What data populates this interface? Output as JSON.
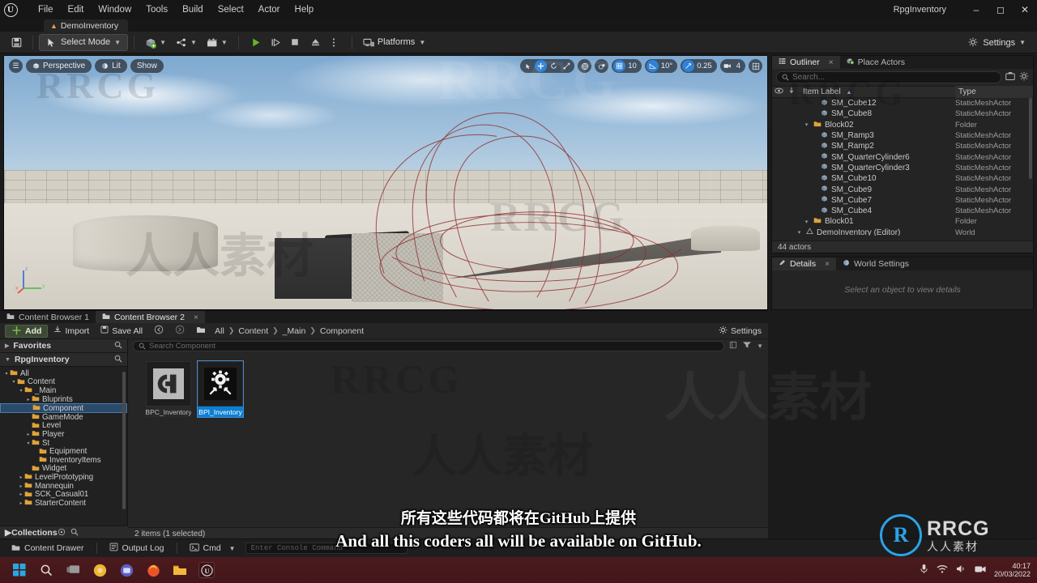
{
  "titlebar": {
    "logo": "ue-logo",
    "menus": [
      "File",
      "Edit",
      "Window",
      "Tools",
      "Build",
      "Select",
      "Actor",
      "Help"
    ],
    "project_name": "RpgInventory",
    "minimize": "–",
    "maximize": "◻",
    "close": "✕"
  },
  "level_tab": {
    "label": "DemoInventory",
    "icon": "level-icon"
  },
  "toolbar": {
    "save_icon": "save-icon",
    "mode_label": "Select Mode",
    "add_icon": "add-actor-icon",
    "blueprint_icon": "blueprints-icon",
    "cinematics_icon": "cinematics-icon",
    "play_icon": "play-icon",
    "skip_icon": "skip-icon",
    "stop_icon": "stop-icon",
    "eject_icon": "eject-icon",
    "options_icon": "play-options-icon",
    "platforms_label": "Platforms",
    "settings_label": "Settings"
  },
  "viewport": {
    "menu_icon": "viewport-menu-icon",
    "camera_label": "Perspective",
    "lighting_label": "Lit",
    "show_label": "Show",
    "transform_tools": [
      "select-icon",
      "move-icon",
      "rotate-icon",
      "scale-icon"
    ],
    "coord_icon": "world-coords-icon",
    "surface_snap_icon": "surface-snap-icon",
    "grid_snap_icon": "grid-snap-icon",
    "grid_snap_value": "10",
    "angle_snap_icon": "angle-snap-icon",
    "angle_snap_value": "10°",
    "scale_snap_icon": "scale-snap-icon",
    "scale_snap_value": "0.25",
    "camera_speed_icon": "camera-speed-icon",
    "camera_speed_value": "4",
    "maximize_icon": "maximize-viewport-icon",
    "gizmo_x": "x",
    "gizmo_y": "y",
    "gizmo_z": "z"
  },
  "outliner": {
    "tab_label": "Outliner",
    "tab_icon": "outliner-icon",
    "tab_close": "×",
    "place_actors_label": "Place Actors",
    "place_actors_icon": "place-actors-icon",
    "search_placeholder": "Search...",
    "search_icon": "search-icon",
    "save_view_icon": "save-view-icon",
    "settings_icon": "gear-icon",
    "col_visibility": "eye-icon",
    "col_pin": "pin-icon",
    "col_label": "Item Label",
    "sort_arrow": "▲",
    "col_type": "Type",
    "rows": [
      {
        "name": "DemoInventory (Editor)",
        "type": "World",
        "indent": 1,
        "icon": "world-icon",
        "twisty": "▾"
      },
      {
        "name": "Block01",
        "type": "Folder",
        "indent": 2,
        "icon": "folder-icon",
        "twisty": "▾"
      },
      {
        "name": "SM_Cube4",
        "type": "StaticMeshActor",
        "indent": 3,
        "icon": "mesh-icon",
        "twisty": ""
      },
      {
        "name": "SM_Cube7",
        "type": "StaticMeshActor",
        "indent": 3,
        "icon": "mesh-icon",
        "twisty": ""
      },
      {
        "name": "SM_Cube9",
        "type": "StaticMeshActor",
        "indent": 3,
        "icon": "mesh-icon",
        "twisty": ""
      },
      {
        "name": "SM_Cube10",
        "type": "StaticMeshActor",
        "indent": 3,
        "icon": "mesh-icon",
        "twisty": ""
      },
      {
        "name": "SM_QuarterCylinder3",
        "type": "StaticMeshActor",
        "indent": 3,
        "icon": "mesh-icon",
        "twisty": ""
      },
      {
        "name": "SM_QuarterCylinder6",
        "type": "StaticMeshActor",
        "indent": 3,
        "icon": "mesh-icon",
        "twisty": ""
      },
      {
        "name": "SM_Ramp2",
        "type": "StaticMeshActor",
        "indent": 3,
        "icon": "mesh-icon",
        "twisty": ""
      },
      {
        "name": "SM_Ramp3",
        "type": "StaticMeshActor",
        "indent": 3,
        "icon": "mesh-icon",
        "twisty": ""
      },
      {
        "name": "Block02",
        "type": "Folder",
        "indent": 2,
        "icon": "folder-icon",
        "twisty": "▾"
      },
      {
        "name": "SM_Cube8",
        "type": "StaticMeshActor",
        "indent": 3,
        "icon": "mesh-icon",
        "twisty": ""
      },
      {
        "name": "SM_Cube12",
        "type": "StaticMeshActor",
        "indent": 3,
        "icon": "mesh-icon",
        "twisty": ""
      }
    ],
    "status": "44 actors"
  },
  "details": {
    "tab_label": "Details",
    "tab_icon": "details-icon",
    "tab_close": "×",
    "world_settings_label": "World Settings",
    "world_settings_icon": "world-settings-icon",
    "empty_message": "Select an object to view details"
  },
  "content_browser": {
    "tabs": [
      {
        "label": "Content Browser 1",
        "active": false,
        "close": ""
      },
      {
        "label": "Content Browser 2",
        "active": true,
        "close": "×"
      }
    ],
    "add_label": "Add",
    "add_icon": "plus-icon",
    "import_label": "Import",
    "import_icon": "import-icon",
    "save_all_label": "Save All",
    "save_all_icon": "save-icon",
    "back_icon": "back-arrow-icon",
    "forward_icon": "forward-arrow-icon",
    "path_icon": "folder-icon",
    "breadcrumbs": [
      "All",
      "Content",
      "_Main",
      "Component"
    ],
    "breadcrumb_sep": "❯",
    "settings_label": "Settings",
    "settings_icon": "gear-icon",
    "favorites_label": "Favorites",
    "favorites_search_icon": "search-icon",
    "source_label": "RpgInventory",
    "source_search_icon": "search-icon",
    "collections_label": "Collections",
    "collections_add_icon": "add-collection-icon",
    "collections_search_icon": "search-icon",
    "folder_tree": [
      {
        "name": "All",
        "indent": 0,
        "twisty": "▾",
        "selected": false
      },
      {
        "name": "Content",
        "indent": 1,
        "twisty": "▾",
        "selected": false
      },
      {
        "name": "_Main",
        "indent": 2,
        "twisty": "▾",
        "selected": false
      },
      {
        "name": "Bluprints",
        "indent": 3,
        "twisty": "▸",
        "selected": false
      },
      {
        "name": "Component",
        "indent": 3,
        "twisty": "",
        "selected": true
      },
      {
        "name": "GameMode",
        "indent": 3,
        "twisty": "",
        "selected": false
      },
      {
        "name": "Level",
        "indent": 3,
        "twisty": "",
        "selected": false
      },
      {
        "name": "Player",
        "indent": 3,
        "twisty": "▸",
        "selected": false
      },
      {
        "name": "St",
        "indent": 3,
        "twisty": "▾",
        "selected": false
      },
      {
        "name": "Equipment",
        "indent": 4,
        "twisty": "",
        "selected": false
      },
      {
        "name": "InventoryItems",
        "indent": 4,
        "twisty": "",
        "selected": false
      },
      {
        "name": "Widget",
        "indent": 3,
        "twisty": "",
        "selected": false
      },
      {
        "name": "LevelPrototyping",
        "indent": 2,
        "twisty": "▸",
        "selected": false
      },
      {
        "name": "Mannequin",
        "indent": 2,
        "twisty": "▸",
        "selected": false
      },
      {
        "name": "SCK_Casual01",
        "indent": 2,
        "twisty": "▸",
        "selected": false
      },
      {
        "name": "StarterContent",
        "indent": 2,
        "twisty": "▸",
        "selected": false
      }
    ],
    "search_placeholder": "Search Component",
    "search_icon": "search-icon",
    "view_options_icon": "view-options-icon",
    "filter_icon": "filter-icon",
    "assets": [
      {
        "name": "BPC_Inventory",
        "icon": "blueprint-component-icon",
        "selected": false
      },
      {
        "name": "BPI_Inventory",
        "icon": "blueprint-interface-icon",
        "selected": true
      }
    ],
    "status": "2 items (1 selected)"
  },
  "statusbar": {
    "content_drawer_label": "Content Drawer",
    "content_drawer_icon": "drawer-icon",
    "output_log_label": "Output Log",
    "output_log_icon": "log-icon",
    "cmd_label": "Cmd",
    "cmd_icon": "console-icon",
    "console_placeholder": "Enter Console Command"
  },
  "taskbar": {
    "items": [
      "windows-start-icon",
      "search-icon",
      "task-view-icon",
      "chrome-icon",
      "teams-icon",
      "firefox-icon",
      "file-explorer-icon",
      "unreal-engine-icon"
    ],
    "tray": [
      "mic-icon",
      "wifi-icon",
      "volume-icon",
      "camera-icon"
    ],
    "time": "40:17",
    "date": "20/03/2022"
  },
  "subtitles": {
    "chinese": "所有这些代码都将在GitHub上提供",
    "english": "And all this coders all will be available on GitHub."
  },
  "branding": {
    "logo_letter": "R",
    "name": "RRCG",
    "chinese_name": "人人素材",
    "accent": "#2aa3e8",
    "watermark_text": "RRCG",
    "watermark_cn": "人人素材"
  },
  "colors": {
    "panel_bg": "#242424",
    "titlebar_bg": "#161616",
    "selection_blue": "#0b7fd4",
    "accent_blue": "#2f82d8",
    "folder_yellow": "#e0a33a",
    "taskbar_red": "#4b1a1d"
  }
}
